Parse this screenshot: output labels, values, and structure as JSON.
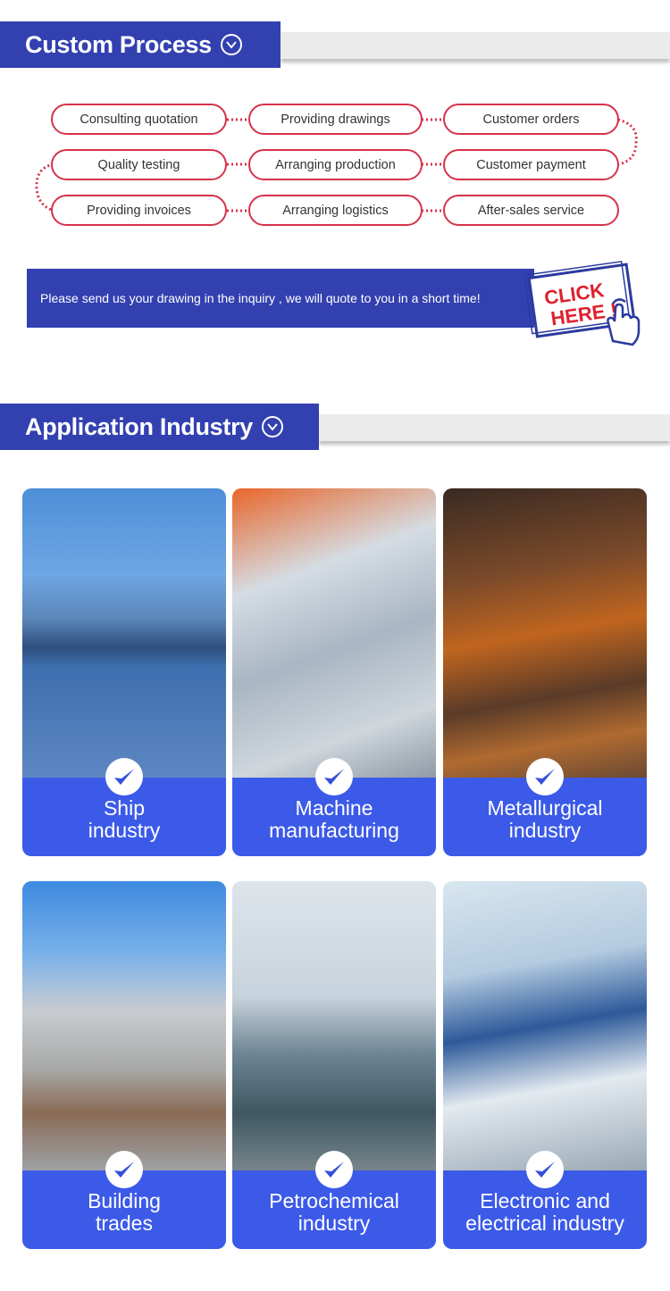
{
  "custom_process": {
    "title": "Custom Process",
    "steps": [
      "Consulting quotation",
      "Providing drawings",
      "Customer orders",
      "Customer payment",
      "Arranging production",
      "Quality testing",
      "Providing invoices",
      "Arranging logistics",
      "After-sales service"
    ]
  },
  "banner": {
    "text": "Please send us your drawing in the inquiry , we will quote to you in a short time!",
    "cta_line1": "CLICK",
    "cta_line2": "HERE !"
  },
  "application_industry": {
    "title": "Application Industry",
    "cards": [
      {
        "line1": "Ship",
        "line2": "industry",
        "icon": "check-icon"
      },
      {
        "line1": "Machine",
        "line2": "manufacturing",
        "icon": "check-icon"
      },
      {
        "line1": "Metallurgical",
        "line2": "industry",
        "icon": "check-icon"
      },
      {
        "line1": "Building",
        "line2": "trades",
        "icon": "check-icon"
      },
      {
        "line1": "Petrochemical",
        "line2": "industry",
        "icon": "check-icon"
      },
      {
        "line1": "Electronic and",
        "line2": "electrical industry",
        "icon": "check-icon"
      }
    ]
  },
  "colors": {
    "brand_blue": "#3240b0",
    "card_blue": "#3c5ae8",
    "accent_red": "#d6324a"
  }
}
